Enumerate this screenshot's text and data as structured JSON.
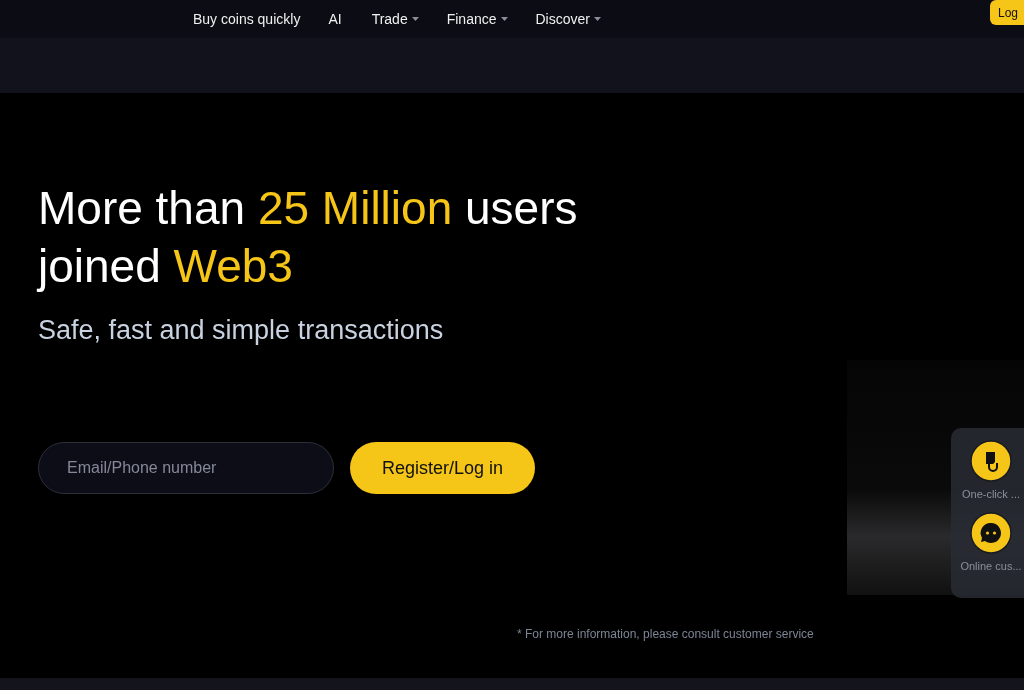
{
  "nav": {
    "items": [
      {
        "label": "Buy coins quickly",
        "dropdown": false
      },
      {
        "label": "AI",
        "dropdown": false
      },
      {
        "label": "Trade",
        "dropdown": true
      },
      {
        "label": "Finance",
        "dropdown": true
      },
      {
        "label": "Discover",
        "dropdown": true
      }
    ],
    "login_button": "Log"
  },
  "hero": {
    "headline": [
      [
        {
          "text": "More than ",
          "highlight": false
        },
        {
          "text": "25 Million",
          "highlight": true
        },
        {
          "text": " users",
          "highlight": false
        }
      ],
      [
        {
          "text": "joined ",
          "highlight": false
        },
        {
          "text": "Web3",
          "highlight": true
        }
      ]
    ],
    "subtitle": "Safe, fast and simple transactions",
    "search": {
      "placeholder": "Email/Phone number"
    },
    "register_button": "Register/Log in",
    "footnote": "* For more information, please consult customer service"
  },
  "float_panel": [
    {
      "kind": "click",
      "label": "One-click ..."
    },
    {
      "kind": "chat",
      "label": "Online cus..."
    }
  ]
}
